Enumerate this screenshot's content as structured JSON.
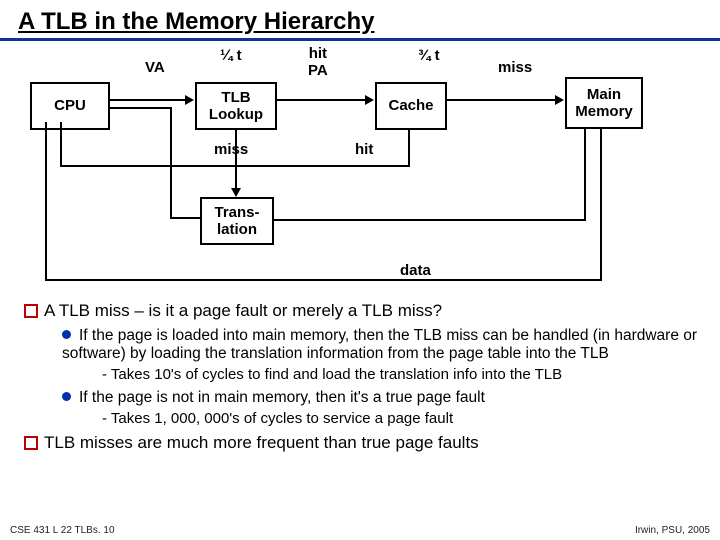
{
  "title": "A TLB in the Memory Hierarchy",
  "diagram": {
    "cpu": "CPU",
    "va": "VA",
    "quarter_t": "¼ t",
    "hit_pa": "hit\nPA",
    "three_quarter_t": "¾ t",
    "miss_top": "miss",
    "tlb_lookup": "TLB\nLookup",
    "cache": "Cache",
    "main_memory": "Main\nMemory",
    "miss_bottom": "miss",
    "hit_bottom": "hit",
    "translation": "Trans-\nlation",
    "data": "data"
  },
  "bullets": {
    "q1": "A TLB miss – is it a page fault or merely a TLB miss?",
    "d1": "If the page is loaded into main memory, then the TLB miss can be handled (in hardware or software) by loading the translation information from the page table into the TLB",
    "s1": "- Takes 10's of cycles to find and load the translation info into the TLB",
    "d2": "If the page is not in main memory, then it's a true page fault",
    "s2": "- Takes 1, 000, 000's of cycles to service a page fault",
    "q2": "TLB misses are much more frequent than true page faults"
  },
  "footer": {
    "left": "CSE 431  L 22  TLBs. 10",
    "right": "Irwin, PSU, 2005"
  }
}
